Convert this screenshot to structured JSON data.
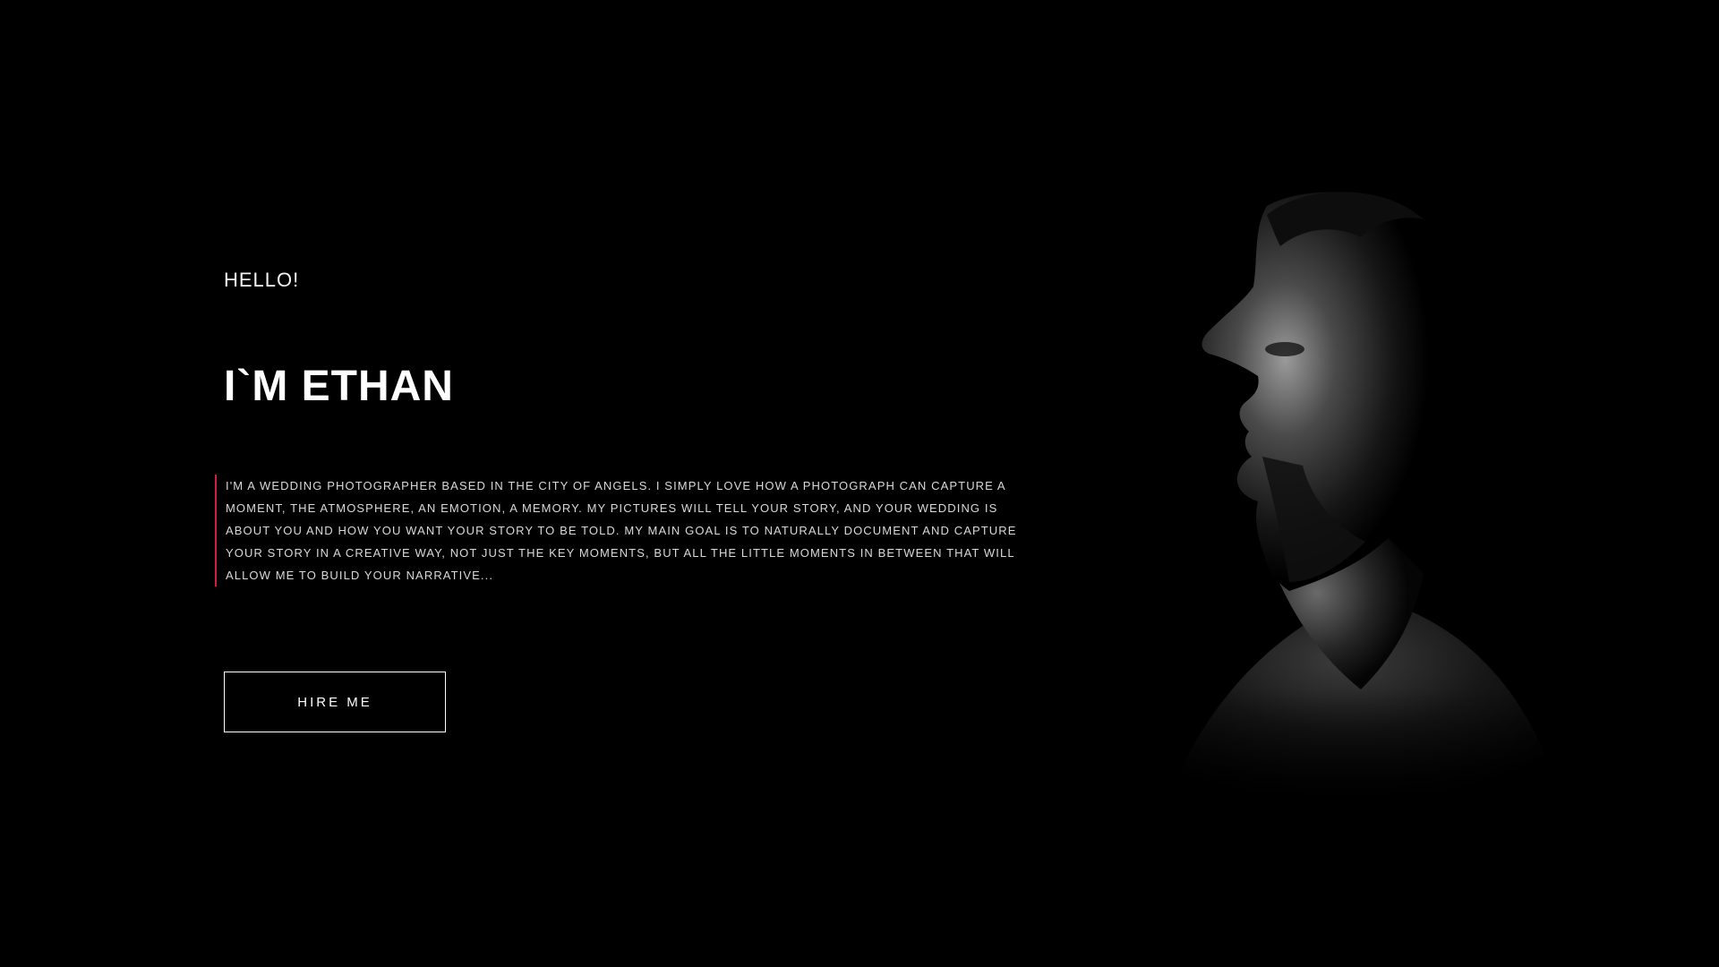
{
  "hero": {
    "greeting": "HELLO!",
    "name": "I`M ETHAN",
    "bio": "I'M A WEDDING PHOTOGRAPHER BASED IN THE CITY OF ANGELS. I SIMPLY LOVE HOW A PHOTOGRAPH CAN CAPTURE A MOMENT, THE ATMOSPHERE, AN EMOTION, A MEMORY. MY PICTURES WILL TELL YOUR STORY, AND YOUR WEDDING IS ABOUT YOU AND HOW YOU WANT YOUR STORY TO BE TOLD. MY MAIN GOAL IS TO NATURALLY DOCUMENT AND CAPTURE YOUR STORY IN A CREATIVE WAY, NOT JUST THE KEY MOMENTS, BUT ALL THE LITTLE MOMENTS IN BETWEEN THAT WILL ALLOW ME TO BUILD YOUR NARRATIVE...",
    "button_label": "HIRE ME"
  },
  "portrait": {
    "icon": "portrait-silhouette"
  },
  "colors": {
    "background": "#000000",
    "text": "#ffffff",
    "accent": "#d21e45"
  }
}
